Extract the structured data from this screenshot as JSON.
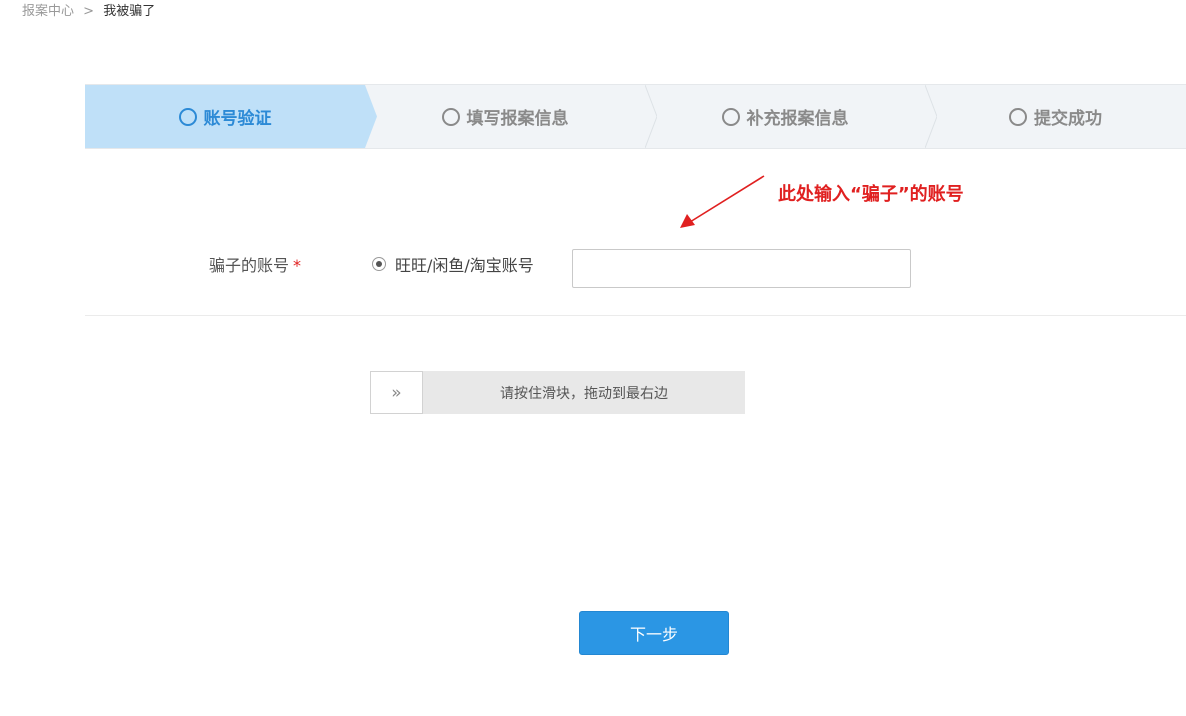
{
  "breadcrumb": {
    "parent": "报案中心",
    "separator": ">",
    "current": "我被骗了"
  },
  "steps": [
    {
      "label": "账号验证",
      "active": true
    },
    {
      "label": "填写报案信息",
      "active": false
    },
    {
      "label": "补充报案信息",
      "active": false
    },
    {
      "label": "提交成功",
      "active": false
    }
  ],
  "annotation": {
    "text": "此处输入“骗子”的账号",
    "color": "#e02020"
  },
  "form": {
    "label": "骗子的账号",
    "required_mark": "*",
    "radio_label": "旺旺/闲鱼/淘宝账号",
    "radio_selected": true,
    "input_value": "",
    "input_placeholder": ""
  },
  "slider": {
    "handle_symbol": "»",
    "instruction": "请按住滑块，拖动到最右边",
    "progress": 0
  },
  "next_button": {
    "label": "下一步"
  },
  "colors": {
    "accent": "#2b96e4",
    "active_step_bg": "#bfe0f8",
    "active_step_text": "#2c8ad6",
    "inactive_step_bg": "#f1f4f7",
    "required": "#e02020"
  }
}
